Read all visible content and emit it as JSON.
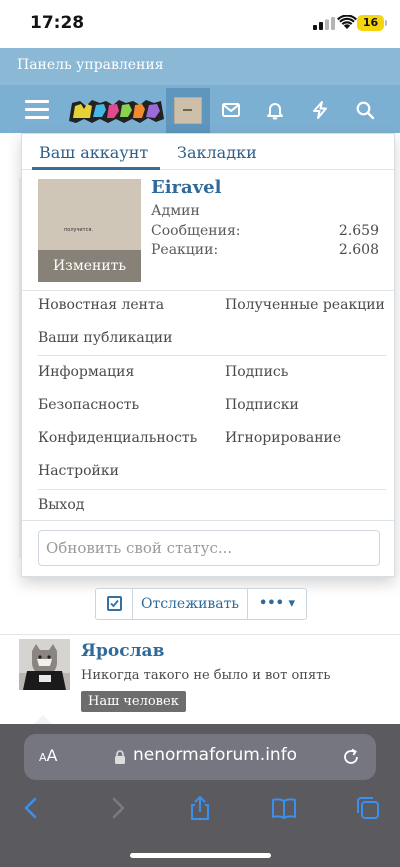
{
  "status_bar": {
    "time": "17:28",
    "battery": "16"
  },
  "header": {
    "admin_bar_label": "Панель управления",
    "logo_text": "neNORMA"
  },
  "dropdown": {
    "tabs": [
      {
        "label": "Ваш аккаунт",
        "active": true
      },
      {
        "label": "Закладки",
        "active": false
      }
    ],
    "profile": {
      "username": "Eiravel",
      "role": "Админ",
      "messages_label": "Сообщения:",
      "messages_value": "2.659",
      "reactions_label": "Реакции:",
      "reactions_value": "2.608",
      "edit_label": "Изменить",
      "photo_caption": "получится."
    },
    "links": {
      "news_feed": "Новостная лента",
      "reactions_received": "Полученные реакции",
      "your_posts": "Ваши публикации",
      "information": "Информация",
      "signature": "Подпись",
      "security": "Безопасность",
      "subscriptions": "Подписки",
      "privacy": "Конфиденциальность",
      "ignoring": "Игнорирование",
      "settings": "Настройки",
      "logout": "Выход"
    },
    "status_placeholder": "Обновить свой статус..."
  },
  "page": {
    "watch_label": "Отслеживать",
    "more_label": "••• ▾",
    "post": {
      "author": "Ярослав",
      "text": "Никогда такого не было и вот опять",
      "badge": "Наш человек"
    }
  },
  "browser": {
    "aa_label": "AA",
    "url": "nenormaforum.info"
  },
  "colors": {
    "admin_bar": "#8ab8d5",
    "navbar": "#7cb0d2",
    "link": "#2f6a9a",
    "safari_bar": "#5a5a5f"
  },
  "icons": [
    "menu-icon",
    "envelope-icon",
    "bell-icon",
    "bolt-icon",
    "search-icon",
    "lock-icon",
    "reload-icon",
    "back-icon",
    "forward-icon",
    "share-icon",
    "bookmarks-icon",
    "tabs-icon",
    "checkbox-icon"
  ]
}
